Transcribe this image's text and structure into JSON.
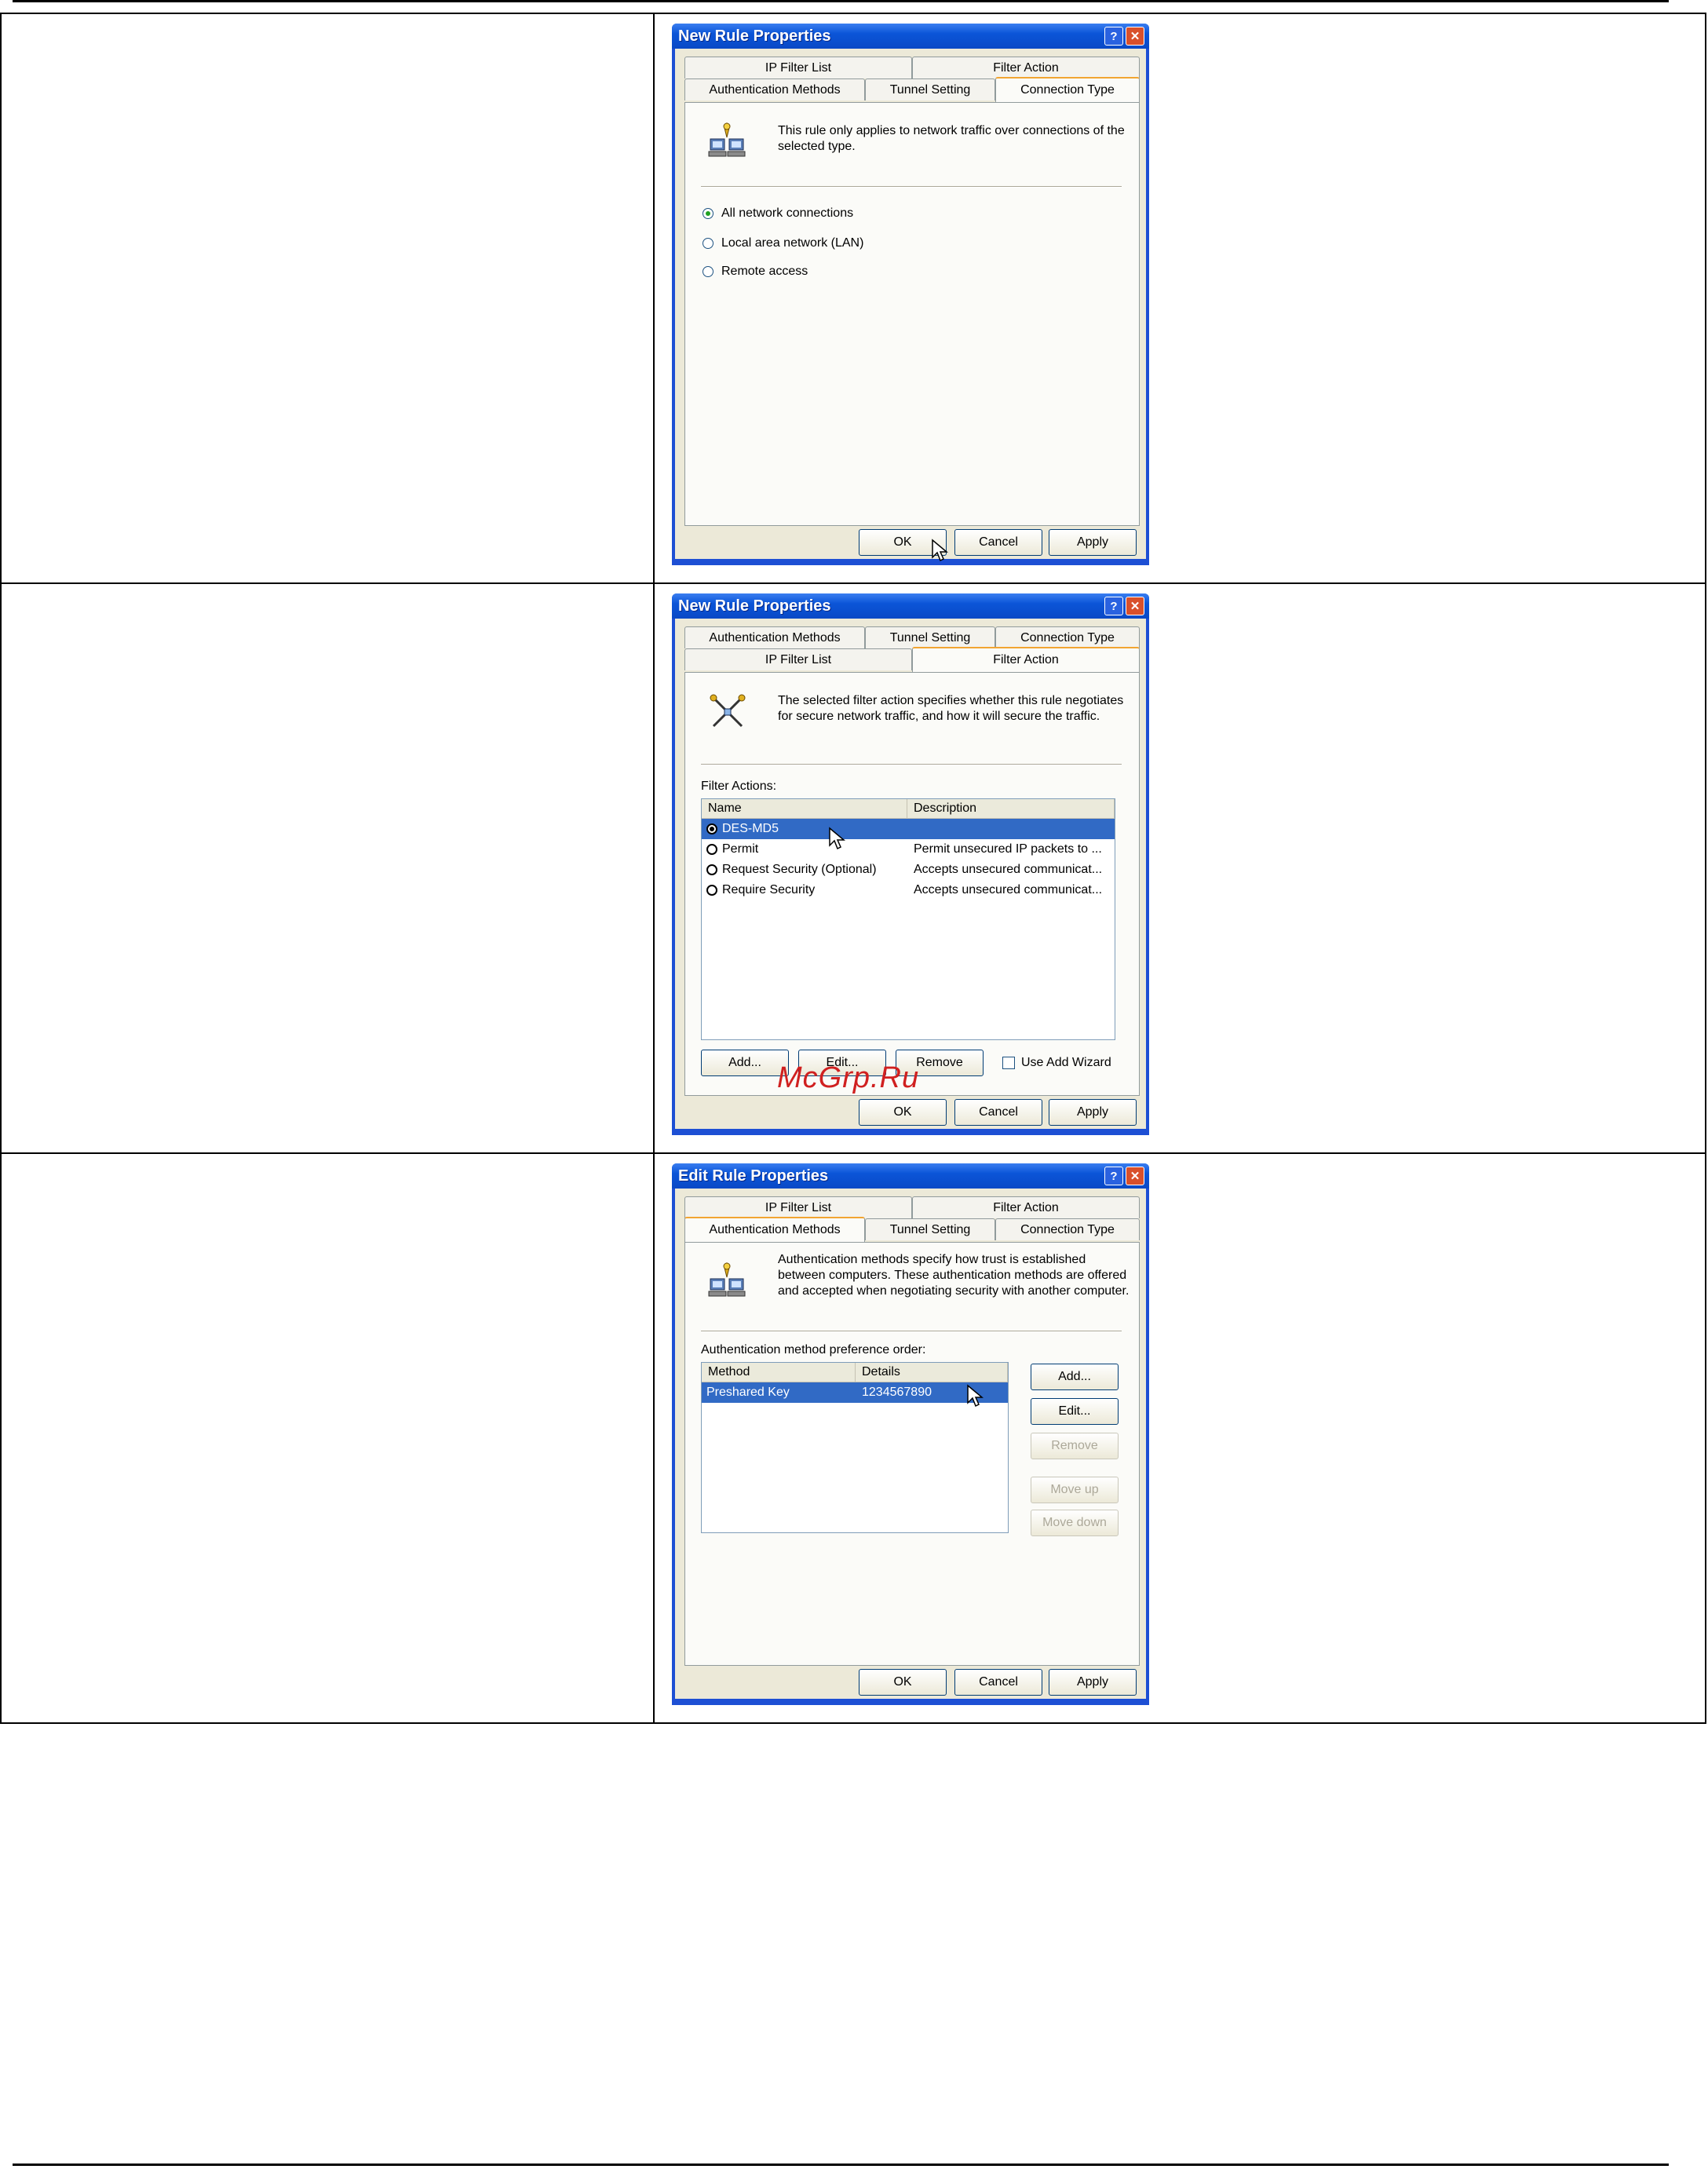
{
  "watermark": "McGrp.Ru",
  "dialog1": {
    "title": "New Rule Properties",
    "help_btn": "?",
    "close_btn": "✕",
    "tabs": [
      "IP Filter List",
      "Filter Action",
      "Authentication Methods",
      "Tunnel Setting",
      "Connection Type"
    ],
    "active_tab": "Connection Type",
    "icon": "network-computers-icon",
    "description": "This rule only applies to network traffic over connections of the selected type.",
    "options": [
      "All network connections",
      "Local area network (LAN)",
      "Remote access"
    ],
    "selected_option": "All network connections",
    "buttons": {
      "ok": "OK",
      "cancel": "Cancel",
      "apply": "Apply"
    }
  },
  "dialog2": {
    "title": "New Rule Properties",
    "help_btn": "?",
    "close_btn": "✕",
    "tabs": [
      "Authentication Methods",
      "Tunnel Setting",
      "Connection Type",
      "IP Filter List",
      "Filter Action"
    ],
    "active_tab": "Filter Action",
    "icon": "filter-action-icon",
    "description": "The selected filter action specifies whether this rule negotiates for secure network traffic, and how it will secure the traffic.",
    "list_label": "Filter Actions:",
    "columns": [
      "Name",
      "Description"
    ],
    "rows": [
      {
        "name": "DES-MD5",
        "description": ""
      },
      {
        "name": "Permit",
        "description": "Permit unsecured IP packets to ..."
      },
      {
        "name": "Request Security (Optional)",
        "description": "Accepts unsecured communicat..."
      },
      {
        "name": "Require Security",
        "description": "Accepts unsecured communicat..."
      }
    ],
    "selected_row": "DES-MD5",
    "list_buttons": {
      "add": "Add...",
      "edit": "Edit...",
      "remove": "Remove"
    },
    "wizard_label": "Use Add Wizard",
    "buttons": {
      "ok": "OK",
      "cancel": "Cancel",
      "apply": "Apply"
    }
  },
  "dialog3": {
    "title": "Edit Rule Properties",
    "help_btn": "?",
    "close_btn": "✕",
    "tabs": [
      "IP Filter List",
      "Filter Action",
      "Authentication Methods",
      "Tunnel Setting",
      "Connection Type"
    ],
    "active_tab": "Authentication Methods",
    "icon": "network-computers-icon",
    "description": "Authentication methods specify how trust is established between computers. These authentication methods are offered and accepted when negotiating security with another computer.",
    "list_label": "Authentication method preference order:",
    "columns": [
      "Method",
      "Details"
    ],
    "rows": [
      {
        "method": "Preshared Key",
        "details": "1234567890"
      }
    ],
    "side_buttons": {
      "add": "Add...",
      "edit": "Edit...",
      "remove": "Remove",
      "move_up": "Move up",
      "move_down": "Move down"
    },
    "buttons": {
      "ok": "OK",
      "cancel": "Cancel",
      "apply": "Apply"
    }
  }
}
